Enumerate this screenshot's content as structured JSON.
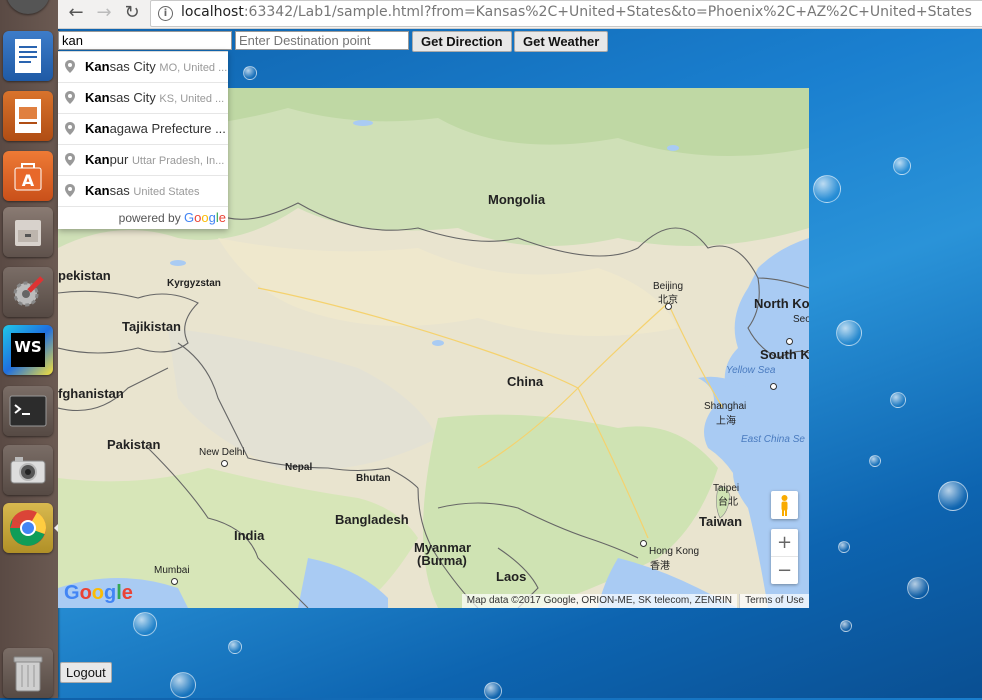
{
  "browser": {
    "url_host": "localhost",
    "url_rest": ":63342/Lab1/sample.html?from=Kansas%2C+United+States&to=Phoenix%2C+AZ%2C+United+States"
  },
  "form": {
    "source_value": "kan",
    "destination_placeholder": "Enter Destination point",
    "get_direction_label": "Get Direction",
    "get_weather_label": "Get Weather",
    "logout_label": "Logout"
  },
  "autocomplete": {
    "items": [
      {
        "match": "Kan",
        "rest": "sas City",
        "secondary": "MO, United ..."
      },
      {
        "match": "Kan",
        "rest": "sas City",
        "secondary": "KS, United ..."
      },
      {
        "match": "Kan",
        "rest": "agawa Prefecture ...",
        "secondary": ""
      },
      {
        "match": "Kan",
        "rest": "pur",
        "secondary": "Uttar Pradesh, In..."
      },
      {
        "match": "Kan",
        "rest": "sas",
        "secondary": "United States"
      }
    ],
    "powered_by": "powered by",
    "brand": {
      "g1": "G",
      "o1": "o",
      "o2": "o",
      "g2": "g",
      "l": "l",
      "e": "e"
    }
  },
  "map": {
    "labels": {
      "mongolia": "Mongolia",
      "kyrgyzstan": "Kyrgyzstan",
      "pekistan": "pekistan",
      "tajikistan": "Tajikistan",
      "afghanistan": "fghanistan",
      "pakistan": "Pakistan",
      "china": "China",
      "beijing": "Beijing",
      "beijing_cn": "北京",
      "north_korea": "North Ko",
      "seoul": "Seo",
      "south_korea": "South K",
      "yellow_sea": "Yellow Sea",
      "shanghai": "Shanghai",
      "shanghai_cn": "上海",
      "east_china_sea": "East China Se",
      "new_delhi": "New Delhi",
      "nepal": "Nepal",
      "bhutan": "Bhutan",
      "taipei": "Taipei",
      "taipei_cn": "台北",
      "taiwan": "Taiwan",
      "india": "India",
      "bangladesh": "Bangladesh",
      "myanmar": "Myanmar",
      "burma": "(Burma)",
      "hong_kong": "Hong Kong",
      "hong_kong_cn": "香港",
      "mumbai": "Mumbai",
      "laos": "Laos"
    },
    "attribution": "Map data ©2017 Google, ORION-ME, SK telecom, ZENRIN",
    "terms": "Terms of Use",
    "zoom_in": "+",
    "zoom_out": "−"
  },
  "launcher": {
    "apps": [
      "writer-icon",
      "impress-icon",
      "software-center-icon",
      "files-icon",
      "settings-icon",
      "webstorm-icon",
      "terminal-icon",
      "camera-icon",
      "chrome-icon",
      "trash-icon"
    ],
    "webstorm_text": "WS"
  }
}
